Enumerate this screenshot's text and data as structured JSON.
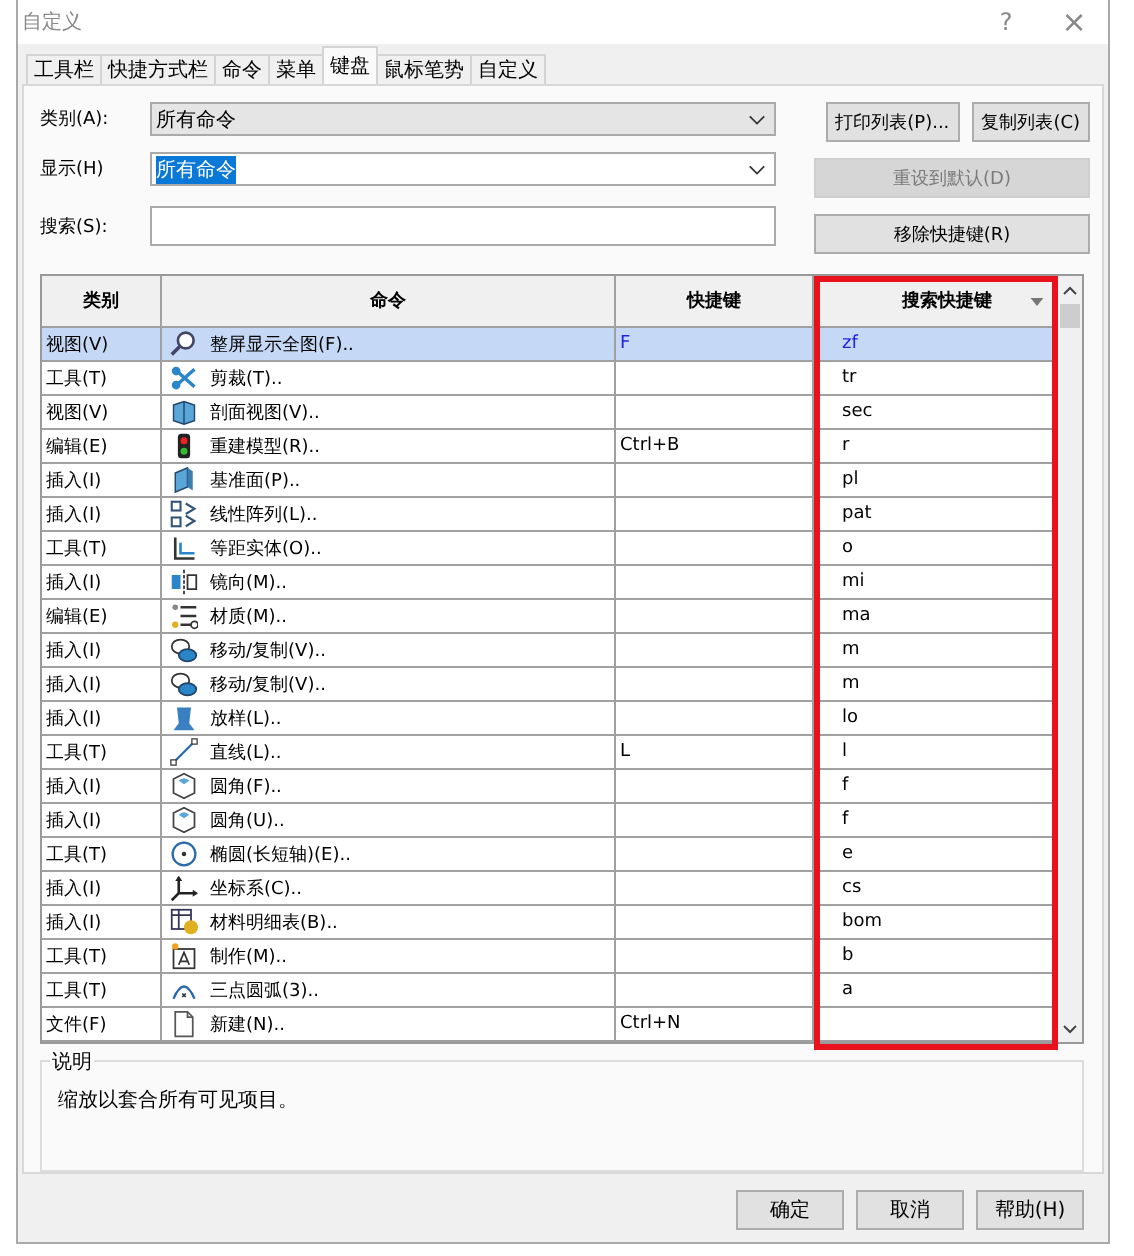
{
  "window": {
    "title": "自定义",
    "help_button": "?",
    "close_button": "×"
  },
  "tabs": [
    {
      "label": "工具栏",
      "selected": false
    },
    {
      "label": "快捷方式栏",
      "selected": false
    },
    {
      "label": "命令",
      "selected": false
    },
    {
      "label": "菜单",
      "selected": false
    },
    {
      "label": "键盘",
      "selected": true
    },
    {
      "label": "鼠标笔势",
      "selected": false
    },
    {
      "label": "自定义",
      "selected": false
    }
  ],
  "filters": {
    "category": {
      "label": "类别(A):",
      "value": "所有命令"
    },
    "show": {
      "label": "显示(H)",
      "value": "所有命令"
    },
    "search": {
      "label": "搜索(S):"
    }
  },
  "side_buttons": [
    {
      "label": "打印列表(P)...",
      "disabled": false
    },
    {
      "label": "复制列表(C)",
      "disabled": false
    },
    {
      "label": "重设到默认(D)",
      "disabled": true
    },
    {
      "label": "移除快捷键(R)",
      "disabled": false
    }
  ],
  "table": {
    "columns": [
      {
        "label": "类别",
        "highlighted": false
      },
      {
        "label": "命令",
        "highlighted": false
      },
      {
        "label": "快捷键",
        "highlighted": false
      },
      {
        "label": "搜索快捷键",
        "highlighted": true
      }
    ],
    "rows": [
      {
        "category": "视图(V)",
        "command": "整屏显示全图(F)..",
        "shortcut": "F",
        "search_shortcut": "zf",
        "selected": true
      },
      {
        "category": "工具(T)",
        "command": "剪裁(T)..",
        "shortcut": "",
        "search_shortcut": "tr",
        "selected": false
      },
      {
        "category": "视图(V)",
        "command": "剖面视图(V)..",
        "shortcut": "",
        "search_shortcut": "sec",
        "selected": false
      },
      {
        "category": "编辑(E)",
        "command": "重建模型(R)..",
        "shortcut": "Ctrl+B",
        "search_shortcut": "r",
        "selected": false
      },
      {
        "category": "插入(I)",
        "command": "基准面(P)..",
        "shortcut": "",
        "search_shortcut": "pl",
        "selected": false
      },
      {
        "category": "插入(I)",
        "command": "线性阵列(L)..",
        "shortcut": "",
        "search_shortcut": "pat",
        "selected": false
      },
      {
        "category": "工具(T)",
        "command": "等距实体(O)..",
        "shortcut": "",
        "search_shortcut": "o",
        "selected": false
      },
      {
        "category": "插入(I)",
        "command": "镜向(M)..",
        "shortcut": "",
        "search_shortcut": "mi",
        "selected": false
      },
      {
        "category": "编辑(E)",
        "command": "材质(M)..",
        "shortcut": "",
        "search_shortcut": "ma",
        "selected": false
      },
      {
        "category": "插入(I)",
        "command": "移动/复制(V)..",
        "shortcut": "",
        "search_shortcut": "m",
        "selected": false
      },
      {
        "category": "插入(I)",
        "command": "移动/复制(V)..",
        "shortcut": "",
        "search_shortcut": "m",
        "selected": false
      },
      {
        "category": "插入(I)",
        "command": "放样(L)..",
        "shortcut": "",
        "search_shortcut": "lo",
        "selected": false
      },
      {
        "category": "工具(T)",
        "command": "直线(L)..",
        "shortcut": "L",
        "search_shortcut": "l",
        "selected": false
      },
      {
        "category": "插入(I)",
        "command": "圆角(F)..",
        "shortcut": "",
        "search_shortcut": "f",
        "selected": false
      },
      {
        "category": "插入(I)",
        "command": "圆角(U)..",
        "shortcut": "",
        "search_shortcut": "f",
        "selected": false
      },
      {
        "category": "工具(T)",
        "command": "椭圆(长短轴)(E)..",
        "shortcut": "",
        "search_shortcut": "e",
        "selected": false
      },
      {
        "category": "插入(I)",
        "command": "坐标系(C)..",
        "shortcut": "",
        "search_shortcut": "cs",
        "selected": false
      },
      {
        "category": "插入(I)",
        "command": "材料明细表(B)..",
        "shortcut": "",
        "search_shortcut": "bom",
        "selected": false
      },
      {
        "category": "工具(T)",
        "command": "制作(M)..",
        "shortcut": "",
        "search_shortcut": "b",
        "selected": false
      },
      {
        "category": "工具(T)",
        "command": "三点圆弧(3)..",
        "shortcut": "",
        "search_shortcut": "a",
        "selected": false
      },
      {
        "category": "文件(F)",
        "command": "新建(N)..",
        "shortcut": "Ctrl+N",
        "search_shortcut": "",
        "selected": false
      }
    ]
  },
  "description": {
    "title": "说明",
    "text": "缩放以套合所有可见项目。"
  },
  "buttons": [
    "确定",
    "取消",
    "帮助(H)"
  ]
}
